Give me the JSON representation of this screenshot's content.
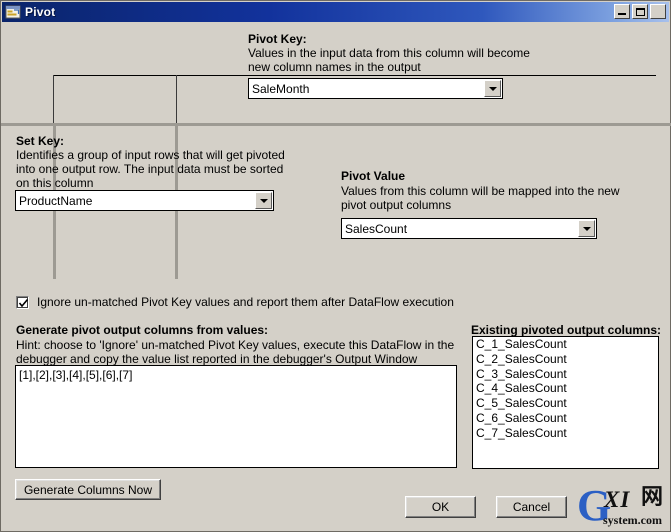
{
  "window": {
    "title": "Pivot",
    "icon": "pivot-app-icon",
    "controls": {
      "minimize": "minimize-icon",
      "maximize": "maximize-icon",
      "close": "close-icon"
    }
  },
  "pivot_key": {
    "label": "Pivot Key:",
    "description": "Values in the input data from this column will become\nnew column names in the output",
    "value": "SaleMonth"
  },
  "set_key": {
    "label": "Set Key:",
    "description": "Identifies a group of input rows that will get pivoted\ninto one output row. The input data must be sorted\non this column",
    "value": "ProductName"
  },
  "pivot_value": {
    "label": "Pivot Value",
    "description": "Values from this column will be mapped into the new\npivot output columns",
    "value": "SalesCount"
  },
  "ignore_option": {
    "label": "Ignore un-matched Pivot Key values and report them after DataFlow execution",
    "checked": true
  },
  "generate": {
    "label": "Generate pivot output columns from values:",
    "hint": "Hint: choose to 'Ignore' un-matched Pivot Key values, execute this DataFlow in the\ndebugger and copy the value list reported in the debugger's Output Window",
    "values": "[1],[2],[3],[4],[5],[6],[7]",
    "button_label": "Generate Columns Now"
  },
  "existing_columns": {
    "label": "Existing pivoted output columns:",
    "items": [
      "C_1_SalesCount",
      "C_2_SalesCount",
      "C_3_SalesCount",
      "C_4_SalesCount",
      "C_5_SalesCount",
      "C_6_SalesCount",
      "C_7_SalesCount"
    ]
  },
  "footer": {
    "ok_label": "OK",
    "cancel_label": "Cancel"
  },
  "watermark": {
    "letter": "G",
    "mid": "XI",
    "cn": "网",
    "domain": "system.com"
  },
  "colors": {
    "titlebar_start": "#0a246a",
    "titlebar_end": "#a7c0ec",
    "dialog_face": "#d4d0c8",
    "field_bg": "#ffffff",
    "watermark_blue": "#2b5fc4"
  }
}
